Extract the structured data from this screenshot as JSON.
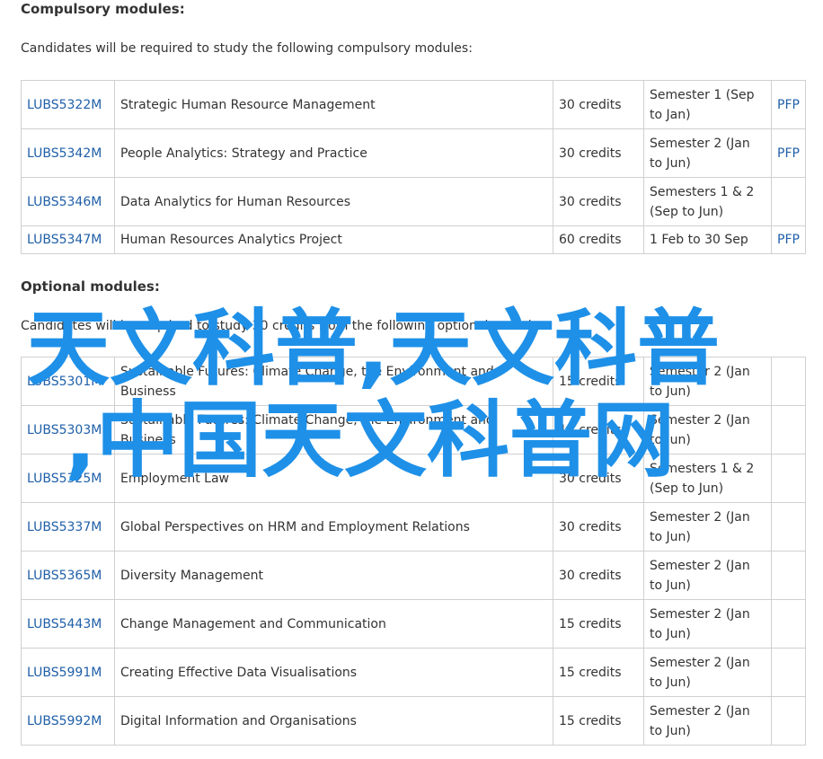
{
  "compulsory": {
    "heading": "Compulsory modules:",
    "intro": "Candidates will be required to study the following compulsory modules:",
    "rows": [
      {
        "code": "LUBS5322M",
        "title": "Strategic Human Resource Management",
        "credits": "30 credits",
        "semester": "Semester 1 (Sep to Jan)",
        "spec": "PFP"
      },
      {
        "code": "LUBS5342M",
        "title": "People Analytics: Strategy and Practice",
        "credits": "30 credits",
        "semester": "Semester 2 (Jan to Jun)",
        "spec": "PFP"
      },
      {
        "code": "LUBS5346M",
        "title": "Data Analytics for Human Resources",
        "credits": "30 credits",
        "semester": "Semesters 1 & 2 (Sep to Jun)",
        "spec": ""
      },
      {
        "code": "LUBS5347M",
        "title": "Human Resources Analytics Project",
        "credits": "60 credits",
        "semester": "1 Feb to 30 Sep",
        "spec": "PFP"
      }
    ]
  },
  "optional": {
    "heading": "Optional modules:",
    "intro": "Candidates will be required to study 30 credits from the following optional modules:",
    "rows": [
      {
        "code": "LUBS5301M",
        "title": "Sustainable Futures: Climate Change, the Environment and Business",
        "credits": "15 credits",
        "semester": "Semester 2 (Jan to Jun)",
        "spec": ""
      },
      {
        "code": "LUBS5303M",
        "title": "Sustainable Futures: Climate Change, the Environment and Business",
        "credits": "15 credits",
        "semester": "Semester 2 (Jan to Jun)",
        "spec": ""
      },
      {
        "code": "LUBS5325M",
        "title": "Employment Law",
        "credits": "30 credits",
        "semester": "Semesters 1 & 2 (Sep to Jun)",
        "spec": ""
      },
      {
        "code": "LUBS5337M",
        "title": "Global Perspectives on HRM and Employment Relations",
        "credits": "30 credits",
        "semester": "Semester 2 (Jan to Jun)",
        "spec": ""
      },
      {
        "code": "LUBS5365M",
        "title": "Diversity Management",
        "credits": "30 credits",
        "semester": "Semester 2 (Jan to Jun)",
        "spec": ""
      },
      {
        "code": "LUBS5443M",
        "title": "Change Management and Communication",
        "credits": "15 credits",
        "semester": "Semester 2 (Jan to Jun)",
        "spec": ""
      },
      {
        "code": "LUBS5991M",
        "title": "Creating Effective Data Visualisations",
        "credits": "15 credits",
        "semester": "Semester 2 (Jan to Jun)",
        "spec": ""
      },
      {
        "code": "LUBS5992M",
        "title": "Digital Information and Organisations",
        "credits": "15 credits",
        "semester": "Semester 2 (Jan to Jun)",
        "spec": ""
      }
    ]
  },
  "watermark": {
    "line1": "天文科普,天文科普",
    "line2": ",中国天文科普网",
    "color": "#1e90e8"
  }
}
